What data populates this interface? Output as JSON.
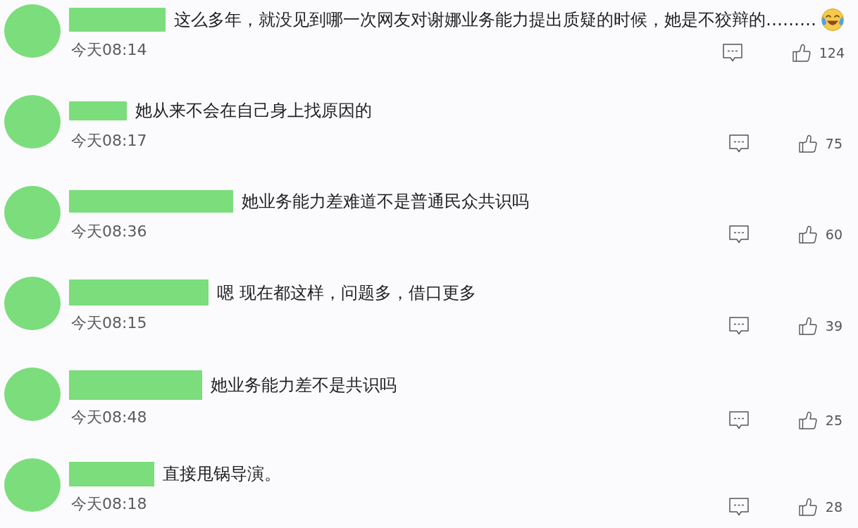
{
  "comments": [
    {
      "text": "这么多年，就没见到哪一次网友对谢娜业务能力提出质疑的时候，她是不狡辩的………",
      "emoji": true,
      "time": "今天08:14",
      "likes": "124"
    },
    {
      "text": "她从来不会在自己身上找原因的",
      "emoji": false,
      "time": "今天08:17",
      "likes": "75"
    },
    {
      "text": "她业务能力差难道不是普通民众共识吗",
      "emoji": false,
      "time": "今天08:36",
      "likes": "60"
    },
    {
      "text": "嗯 现在都这样，问题多，借口更多",
      "emoji": false,
      "time": "今天08:15",
      "likes": "39"
    },
    {
      "text": "她业务能力差不是共识吗",
      "emoji": false,
      "time": "今天08:48",
      "likes": "25"
    },
    {
      "text": "直接甩锅导演。",
      "emoji": false,
      "time": "今天08:18",
      "likes": "28"
    }
  ]
}
